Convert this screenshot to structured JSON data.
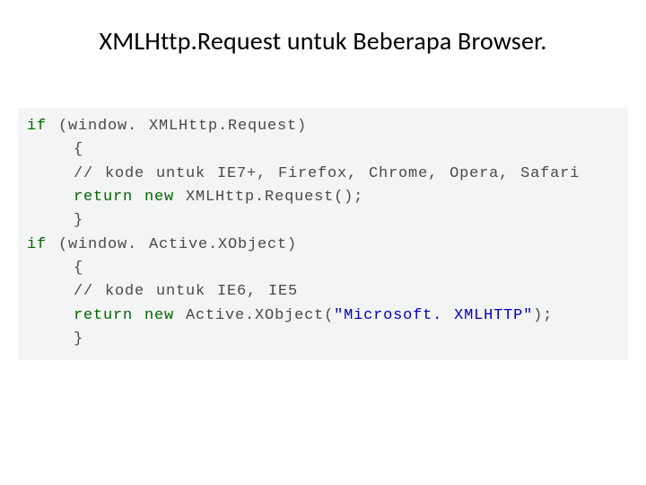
{
  "title": "XMLHttp.Request untuk Beberapa Browser.",
  "code": {
    "l1_kw": "if",
    "l1_rest": " (window. XMLHttp.Request)",
    "l2": "    {",
    "l3": "    // kode untuk IE7+, Firefox, Chrome, Opera, Safari",
    "l4_a": "    ",
    "l4_kw": "return new",
    "l4_b": " XMLHttp.Request();",
    "l5": "    }",
    "l6_kw": "if",
    "l6_rest": " (window. Active.XObject)",
    "l7": "    {",
    "l8": "    // kode untuk IE6, IE5",
    "l9_a": "    ",
    "l9_kw": "return new",
    "l9_b": " Active.XObject(",
    "l9_str": "\"Microsoft. XMLHTTP\"",
    "l9_c": ");",
    "l10": "    }"
  }
}
